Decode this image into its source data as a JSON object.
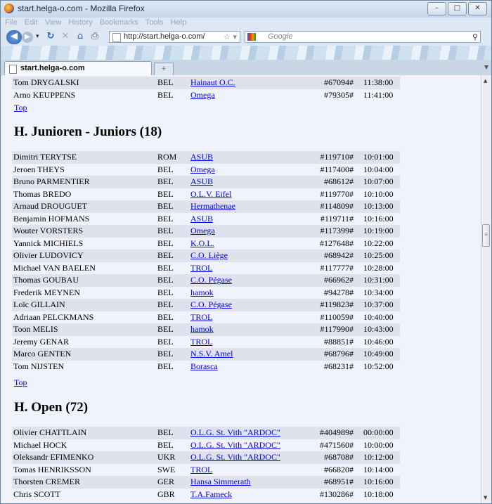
{
  "window": {
    "title": "start.helga-o.com - Mozilla Firefox",
    "buttons": {
      "minimize": "–",
      "maximize": "□",
      "close": "✕"
    }
  },
  "menu": [
    "File",
    "Edit",
    "View",
    "History",
    "Bookmarks",
    "Tools",
    "Help"
  ],
  "nav": {
    "url": "http://start.helga-o.com/",
    "search_placeholder": "Google"
  },
  "tab": {
    "label": "start.helga-o.com",
    "new_tab": "+"
  },
  "page": {
    "top_link": "Top",
    "prev_rows": [
      {
        "name": "Tom DRYGALSKI",
        "country": "BEL",
        "club": "Hainaut O.C.",
        "id": "#67094#",
        "time": "11:38:00"
      },
      {
        "name": "Arno KEUPPENS",
        "country": "BEL",
        "club": "Omega",
        "id": "#79305#",
        "time": "11:41:00"
      }
    ],
    "juniors": {
      "heading": "H. Junioren - Juniors (18)",
      "rows": [
        {
          "name": "Dimitri TERYTSE",
          "country": "ROM",
          "club": "ASUB",
          "id": "#119710#",
          "time": "10:01:00"
        },
        {
          "name": "Jeroen THEYS",
          "country": "BEL",
          "club": "Omega",
          "id": "#117400#",
          "time": "10:04:00"
        },
        {
          "name": "Bruno PARMENTIER",
          "country": "BEL",
          "club": "ASUB",
          "id": "#68612#",
          "time": "10:07:00"
        },
        {
          "name": "Thomas BREDO",
          "country": "BEL",
          "club": "O.L.V. Eifel",
          "id": "#119770#",
          "time": "10:10:00"
        },
        {
          "name": "Arnaud DROUGUET",
          "country": "BEL",
          "club": "Hermathenae",
          "id": "#114809#",
          "time": "10:13:00"
        },
        {
          "name": "Benjamin HOFMANS",
          "country": "BEL",
          "club": "ASUB",
          "id": "#119711#",
          "time": "10:16:00"
        },
        {
          "name": "Wouter VORSTERS",
          "country": "BEL",
          "club": "Omega",
          "id": "#117399#",
          "time": "10:19:00"
        },
        {
          "name": "Yannick MICHIELS",
          "country": "BEL",
          "club": "K.O.L.",
          "id": "#127648#",
          "time": "10:22:00"
        },
        {
          "name": "Olivier LUDOVICY",
          "country": "BEL",
          "club": "C.O. Liège",
          "id": "#68942#",
          "time": "10:25:00"
        },
        {
          "name": "Michael VAN BAELEN",
          "country": "BEL",
          "club": "TROL",
          "id": "#117777#",
          "time": "10:28:00"
        },
        {
          "name": "Thomas GOUBAU",
          "country": "BEL",
          "club": "C.O. Pégase",
          "id": "#66962#",
          "time": "10:31:00"
        },
        {
          "name": "Frederik MEYNEN",
          "country": "BEL",
          "club": "hamok",
          "id": "#94278#",
          "time": "10:34:00"
        },
        {
          "name": "Loïc GILLAIN",
          "country": "BEL",
          "club": "C.O. Pégase",
          "id": "#119823#",
          "time": "10:37:00"
        },
        {
          "name": "Adriaan PELCKMANS",
          "country": "BEL",
          "club": "TROL",
          "id": "#110059#",
          "time": "10:40:00"
        },
        {
          "name": "Toon MELIS",
          "country": "BEL",
          "club": "hamok",
          "id": "#117990#",
          "time": "10:43:00"
        },
        {
          "name": "Jeremy GENAR",
          "country": "BEL",
          "club": "TROL",
          "id": "#88851#",
          "time": "10:46:00"
        },
        {
          "name": "Marco GENTEN",
          "country": "BEL",
          "club": "N.S.V. Amel",
          "id": "#68796#",
          "time": "10:49:00"
        },
        {
          "name": "Tom NIJSTEN",
          "country": "BEL",
          "club": "Borasca",
          "id": "#68231#",
          "time": "10:52:00"
        }
      ]
    },
    "open": {
      "heading": "H. Open (72)",
      "rows": [
        {
          "name": "Olivier CHATTLAIN",
          "country": "BEL",
          "club": "O.L.G. St. Vith \"ARDOC\"",
          "id": "#404989#",
          "time": "00:00:00"
        },
        {
          "name": "Michael HOCK",
          "country": "BEL",
          "club": "O.L.G. St. Vith \"ARDOC\"",
          "id": "#471560#",
          "time": "10:00:00"
        },
        {
          "name": "Oleksandr EFIMENKO",
          "country": "UKR",
          "club": "O.L.G. St. Vith \"ARDOC\"",
          "id": "#68708#",
          "time": "10:12:00"
        },
        {
          "name": "Tomas HENRIKSSON",
          "country": "SWE",
          "club": "TROL",
          "id": "#66820#",
          "time": "10:14:00"
        },
        {
          "name": "Thorsten CREMER",
          "country": "GER",
          "club": "Hansa Simmerath",
          "id": "#68951#",
          "time": "10:16:00"
        },
        {
          "name": "Chris SCOTT",
          "country": "GBR",
          "club": "T.A.Fameck",
          "id": "#130286#",
          "time": "10:18:00"
        }
      ]
    }
  }
}
